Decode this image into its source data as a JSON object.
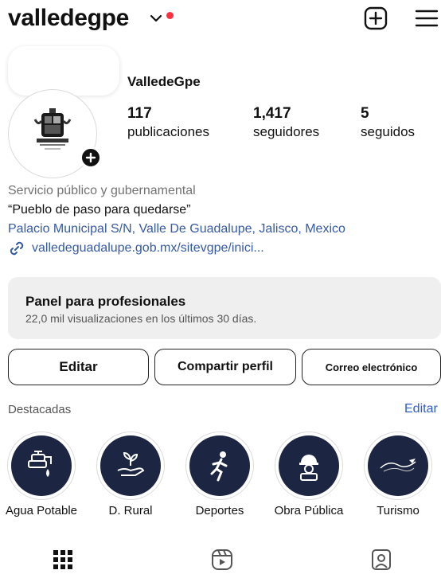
{
  "header": {
    "username": "valledegpe",
    "notification_dot_color": "#ff3040",
    "icons": [
      "chevron-down-icon",
      "new-post-plus-icon",
      "menu-icon"
    ]
  },
  "profile": {
    "display_name": "ValledeGpe",
    "stats": {
      "posts_count": "117",
      "posts_label": "publicaciones",
      "followers_count": "1,417",
      "followers_label": "seguidores",
      "following_count": "5",
      "following_label": "seguidos"
    },
    "bio": {
      "category": "Servicio público y gubernamental",
      "quote": "“Pueblo de paso para quedarse”",
      "address": "Palacio Municipal S/N, Valle De Guadalupe, Jalisco, Mexico",
      "link": "valledeguadalupe.gob.mx/sitevgpe/inici..."
    }
  },
  "panel": {
    "title": "Panel para profesionales",
    "subtitle": "22,0 mil visualizaciones en los últimos 30 días."
  },
  "buttons": {
    "edit": "Editar",
    "share": "Compartir perfil",
    "email": "Correo electrónico"
  },
  "highlights": {
    "title": "Destacadas",
    "edit_label": "Editar",
    "items": [
      {
        "label": "Agua Potable",
        "icon": "water-tap-icon"
      },
      {
        "label": "D. Rural",
        "icon": "plant-hand-icon"
      },
      {
        "label": "Deportes",
        "icon": "runner-icon"
      },
      {
        "label": "Obra Pública",
        "icon": "worker-helmet-icon"
      },
      {
        "label": "Turismo",
        "icon": "tourism-logo-icon"
      }
    ]
  },
  "colors": {
    "link": "#355aa5",
    "highlight_bg": "#1c2541",
    "panel_bg": "#efefef"
  }
}
